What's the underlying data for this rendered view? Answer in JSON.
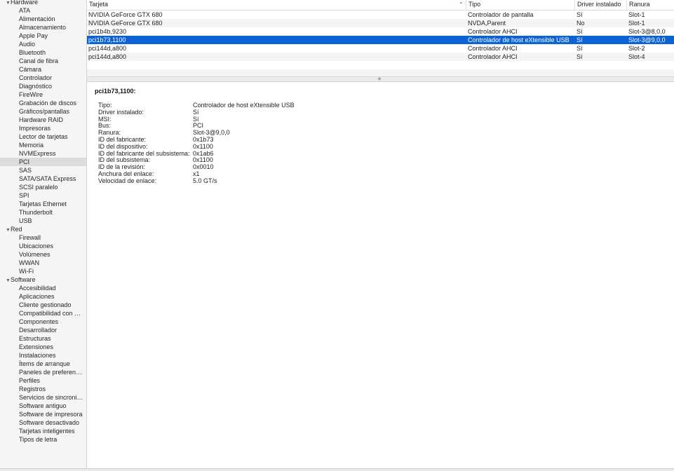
{
  "sidebar": {
    "groups": [
      {
        "label": "Hardware",
        "items": [
          "ATA",
          "Alimentación",
          "Almacenamiento",
          "Apple Pay",
          "Audio",
          "Bluetooth",
          "Canal de fibra",
          "Cámara",
          "Controlador",
          "Diagnóstico",
          "FireWire",
          "Grabación de discos",
          "Gráficos/pantallas",
          "Hardware RAID",
          "Impresoras",
          "Lector de tarjetas",
          "Memoria",
          "NVMExpress",
          "PCI",
          "SAS",
          "SATA/SATA Express",
          "SCSI paralelo",
          "SPI",
          "Tarjetas Ethernet",
          "Thunderbolt",
          "USB"
        ]
      },
      {
        "label": "Red",
        "items": [
          "Firewall",
          "Ubicaciones",
          "Volúmenes",
          "WWAN",
          "Wi-Fi"
        ]
      },
      {
        "label": "Software",
        "items": [
          "Accesibilidad",
          "Aplicaciones",
          "Cliente gestionado",
          "Compatibilidad con ar...",
          "Componentes",
          "Desarrollador",
          "Estructuras",
          "Extensiones",
          "Instalaciones",
          "Ítems de arranque",
          "Paneles de preferenci...",
          "Perfiles",
          "Registros",
          "Servicios de sincroniz...",
          "Software antiguo",
          "Software de impresora",
          "Software desactivado",
          "Tarjetas inteligentes",
          "Tipos de letra"
        ]
      }
    ],
    "selected_item": "PCI"
  },
  "table": {
    "columns": [
      "Tarjeta",
      "Tipo",
      "Driver instalado",
      "Ranura"
    ],
    "sort_indicator": "chevron-up",
    "rows": [
      [
        "NVIDIA GeForce GTX 680",
        "Controlador de pantalla",
        "Sí",
        "Slot-1"
      ],
      [
        "NVIDIA GeForce GTX 680",
        "NVDA,Parent",
        "No",
        "Slot-1"
      ],
      [
        "pci1b4b,9230",
        "Controlador AHCI",
        "Sí",
        "Slot-3@8,0,0"
      ],
      [
        "pci1b73,1100",
        "Controlador de host eXtensible USB",
        "Sí",
        "Slot-3@9,0,0"
      ],
      [
        "pci144d,a800",
        "Controlador AHCI",
        "Sí",
        "Slot-2"
      ],
      [
        "pci144d,a800",
        "Controlador AHCI",
        "Sí",
        "Slot-4"
      ]
    ],
    "selected_row": 3
  },
  "detail": {
    "title": "pci1b73,1100:",
    "properties": [
      {
        "label": "Tipo:",
        "value": "Controlador de host eXtensible USB"
      },
      {
        "label": "Driver instalado:",
        "value": "Sí"
      },
      {
        "label": "MSI:",
        "value": "Sí"
      },
      {
        "label": "Bus:",
        "value": "PCI"
      },
      {
        "label": "Ranura:",
        "value": "Slot-3@9,0,0"
      },
      {
        "label": "ID del fabricante:",
        "value": "0x1b73"
      },
      {
        "label": "ID del dispositivo:",
        "value": "0x1100"
      },
      {
        "label": "ID del fabricante del subsistema:",
        "value": "0x1ab6"
      },
      {
        "label": "ID del subsistema:",
        "value": "0x1100"
      },
      {
        "label": "ID de la revisión:",
        "value": "0x0010"
      },
      {
        "label": "Anchura del enlace:",
        "value": "x1"
      },
      {
        "label": "Velocidad de enlace:",
        "value": "5.0 GT/s"
      }
    ]
  },
  "colors": {
    "selection_blue": "#0b63d5",
    "sidebar_bg": "#f5f5f5",
    "sidebar_selected": "#dcdcdc"
  }
}
